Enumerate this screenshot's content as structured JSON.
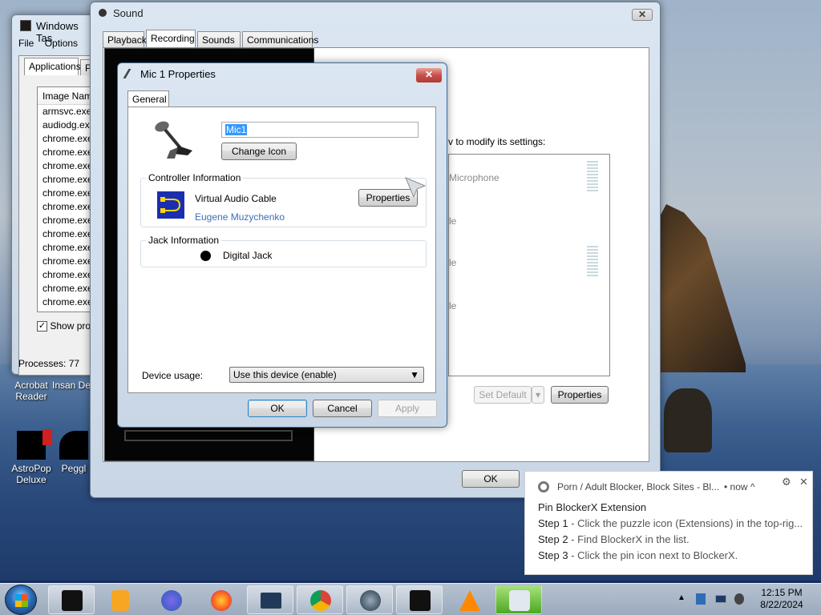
{
  "desktop": {
    "icons": [
      {
        "label": "Acrobat Reader"
      },
      {
        "label": "Insan De"
      },
      {
        "label": "AstroPop Deluxe"
      },
      {
        "label": "Peggl"
      }
    ]
  },
  "task_manager": {
    "title": "Windows Tas",
    "menu": [
      "File",
      "Options"
    ],
    "tab": "Applications",
    "tab2": "P",
    "column": "Image Name",
    "rows": [
      "armsvc.exe",
      "audiodg.exe",
      "chrome.exe",
      "chrome.exe",
      "chrome.exe",
      "chrome.exe",
      "chrome.exe",
      "chrome.exe",
      "chrome.exe",
      "chrome.exe",
      "chrome.exe",
      "chrome.exe",
      "chrome.exe",
      "chrome.exe",
      "chrome.exe"
    ],
    "show_processes": "Show proce",
    "processes": "Processes: 77"
  },
  "sound": {
    "title": "Sound",
    "tabs": [
      "Playback",
      "Recording",
      "Sounds",
      "Communications"
    ],
    "instruction": "v to modify its settings:",
    "device_label": "Microphone",
    "partials": [
      "le",
      "le",
      "le"
    ],
    "set_default": "Set Default",
    "properties": "Properties",
    "ok": "OK"
  },
  "mic": {
    "title": "Mic 1 Properties",
    "tab": "General",
    "name_value": "Mic1",
    "change_icon": "Change Icon",
    "controller_group": "Controller Information",
    "controller_name": "Virtual Audio Cable",
    "controller_vendor": "Eugene Muzychenko",
    "properties": "Properties",
    "jack_group": "Jack Information",
    "jack_name": "Digital Jack",
    "device_usage_label": "Device usage:",
    "device_usage_value": "Use this device (enable)",
    "ok": "OK",
    "cancel": "Cancel",
    "apply": "Apply"
  },
  "notification": {
    "source": "Porn / Adult Blocker, Block Sites - Bl...",
    "time": "• now ^",
    "title": "Pin BlockerX Extension",
    "steps": [
      {
        "label": "Step 1",
        "text": " - Click the puzzle icon (Extensions) in the top-rig..."
      },
      {
        "label": "Step 2",
        "text": " - Find BlockerX in the list."
      },
      {
        "label": "Step 3",
        "text": " - Click the pin icon next to BlockerX."
      }
    ]
  },
  "clock": {
    "time": "12:15 PM",
    "date": "8/22/2024"
  },
  "colors": {
    "accent": "#3399ff",
    "link": "#3d6fb6",
    "close_red": "#c75050"
  }
}
